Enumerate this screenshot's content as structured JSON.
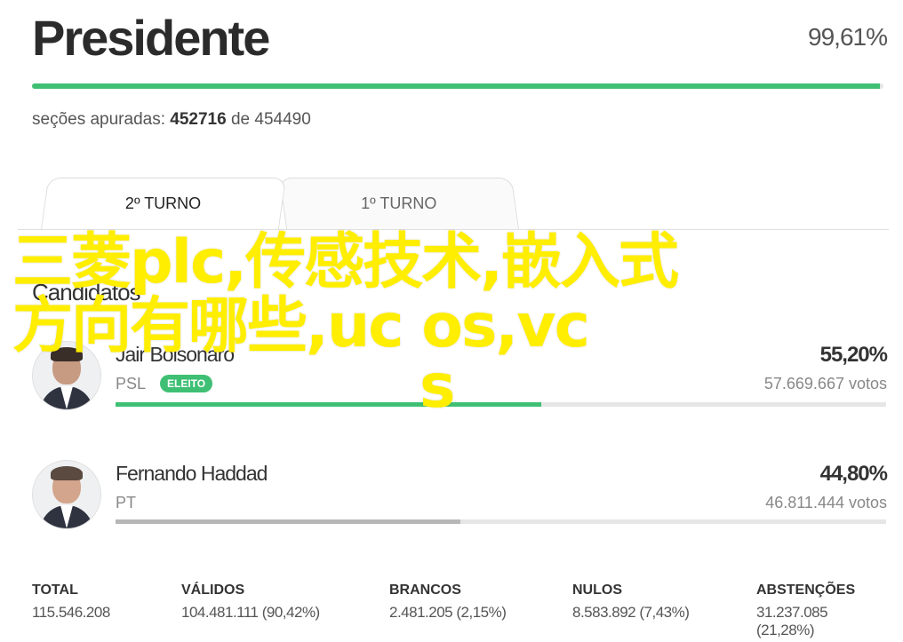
{
  "header": {
    "title": "Presidente",
    "percent": "99,61%",
    "progress": 99.61
  },
  "secoes": {
    "label": "seções apuradas:",
    "apuradas": "452716",
    "de": "de",
    "total": "454490"
  },
  "tabs": [
    {
      "label": "2º TURNO",
      "active": true
    },
    {
      "label": "1º TURNO",
      "active": false
    }
  ],
  "section_label": "Candidatos",
  "candidates": [
    {
      "name": "Jair Bolsonaro",
      "party": "PSL",
      "badge": "ELEITO",
      "percent": "55,20%",
      "votes": "57.669.667 votos",
      "share": 55.2,
      "bar_color": "#3fbf74"
    },
    {
      "name": "Fernando Haddad",
      "party": "PT",
      "badge": "",
      "percent": "44,80%",
      "votes": "46.811.444 votos",
      "share": 44.8,
      "bar_color": "#b7b7b7"
    }
  ],
  "stats": [
    {
      "label": "TOTAL",
      "value": "115.546.208"
    },
    {
      "label": "VÁLIDOS",
      "value": "104.481.111 (90,42%)"
    },
    {
      "label": "BRANCOS",
      "value": "2.481.205 (2,15%)"
    },
    {
      "label": "NULOS",
      "value": "8.583.892 (7,43%)"
    },
    {
      "label": "ABSTENÇÕES",
      "value": "31.237.085 (21,28%)"
    }
  ],
  "overlay": {
    "line1": "三菱plc,传感技术,嵌入式",
    "line2": "方向有哪些,uc os,vc",
    "line3": "s"
  }
}
